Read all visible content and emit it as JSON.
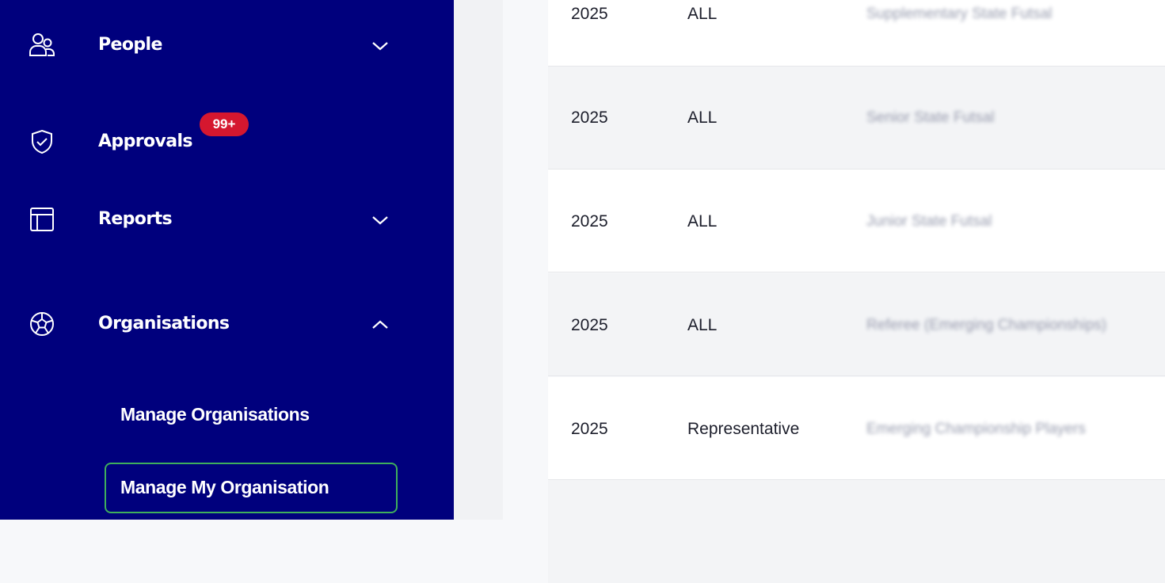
{
  "sidebar": {
    "items": [
      {
        "label": "People",
        "icon": "people-icon",
        "expandable": true,
        "expanded": false
      },
      {
        "label": "Approvals",
        "icon": "shield-check-icon",
        "badge": "99+"
      },
      {
        "label": "Reports",
        "icon": "table-layout-icon",
        "expandable": true,
        "expanded": false
      },
      {
        "label": "Organisations",
        "icon": "football-icon",
        "expandable": true,
        "expanded": true
      }
    ],
    "submenu": [
      {
        "label": "Manage Organisations",
        "active": false
      },
      {
        "label": "Manage My Organisation",
        "active": true
      }
    ]
  },
  "table": {
    "rows": [
      {
        "year": "2025",
        "type": "ALL",
        "name": "Supplementary State Futsal"
      },
      {
        "year": "2025",
        "type": "ALL",
        "name": "Senior State Futsal"
      },
      {
        "year": "2025",
        "type": "ALL",
        "name": "Junior State Futsal"
      },
      {
        "year": "2025",
        "type": "ALL",
        "name": "Referee (Emerging Championships)"
      },
      {
        "year": "2025",
        "type": "Representative",
        "name": "Emerging Championship Players"
      },
      {
        "year": "",
        "type": "",
        "name": ""
      }
    ]
  },
  "colors": {
    "sidebar_bg": "#00007d",
    "badge": "#d5172f",
    "active_outline": "#3fae5c"
  }
}
